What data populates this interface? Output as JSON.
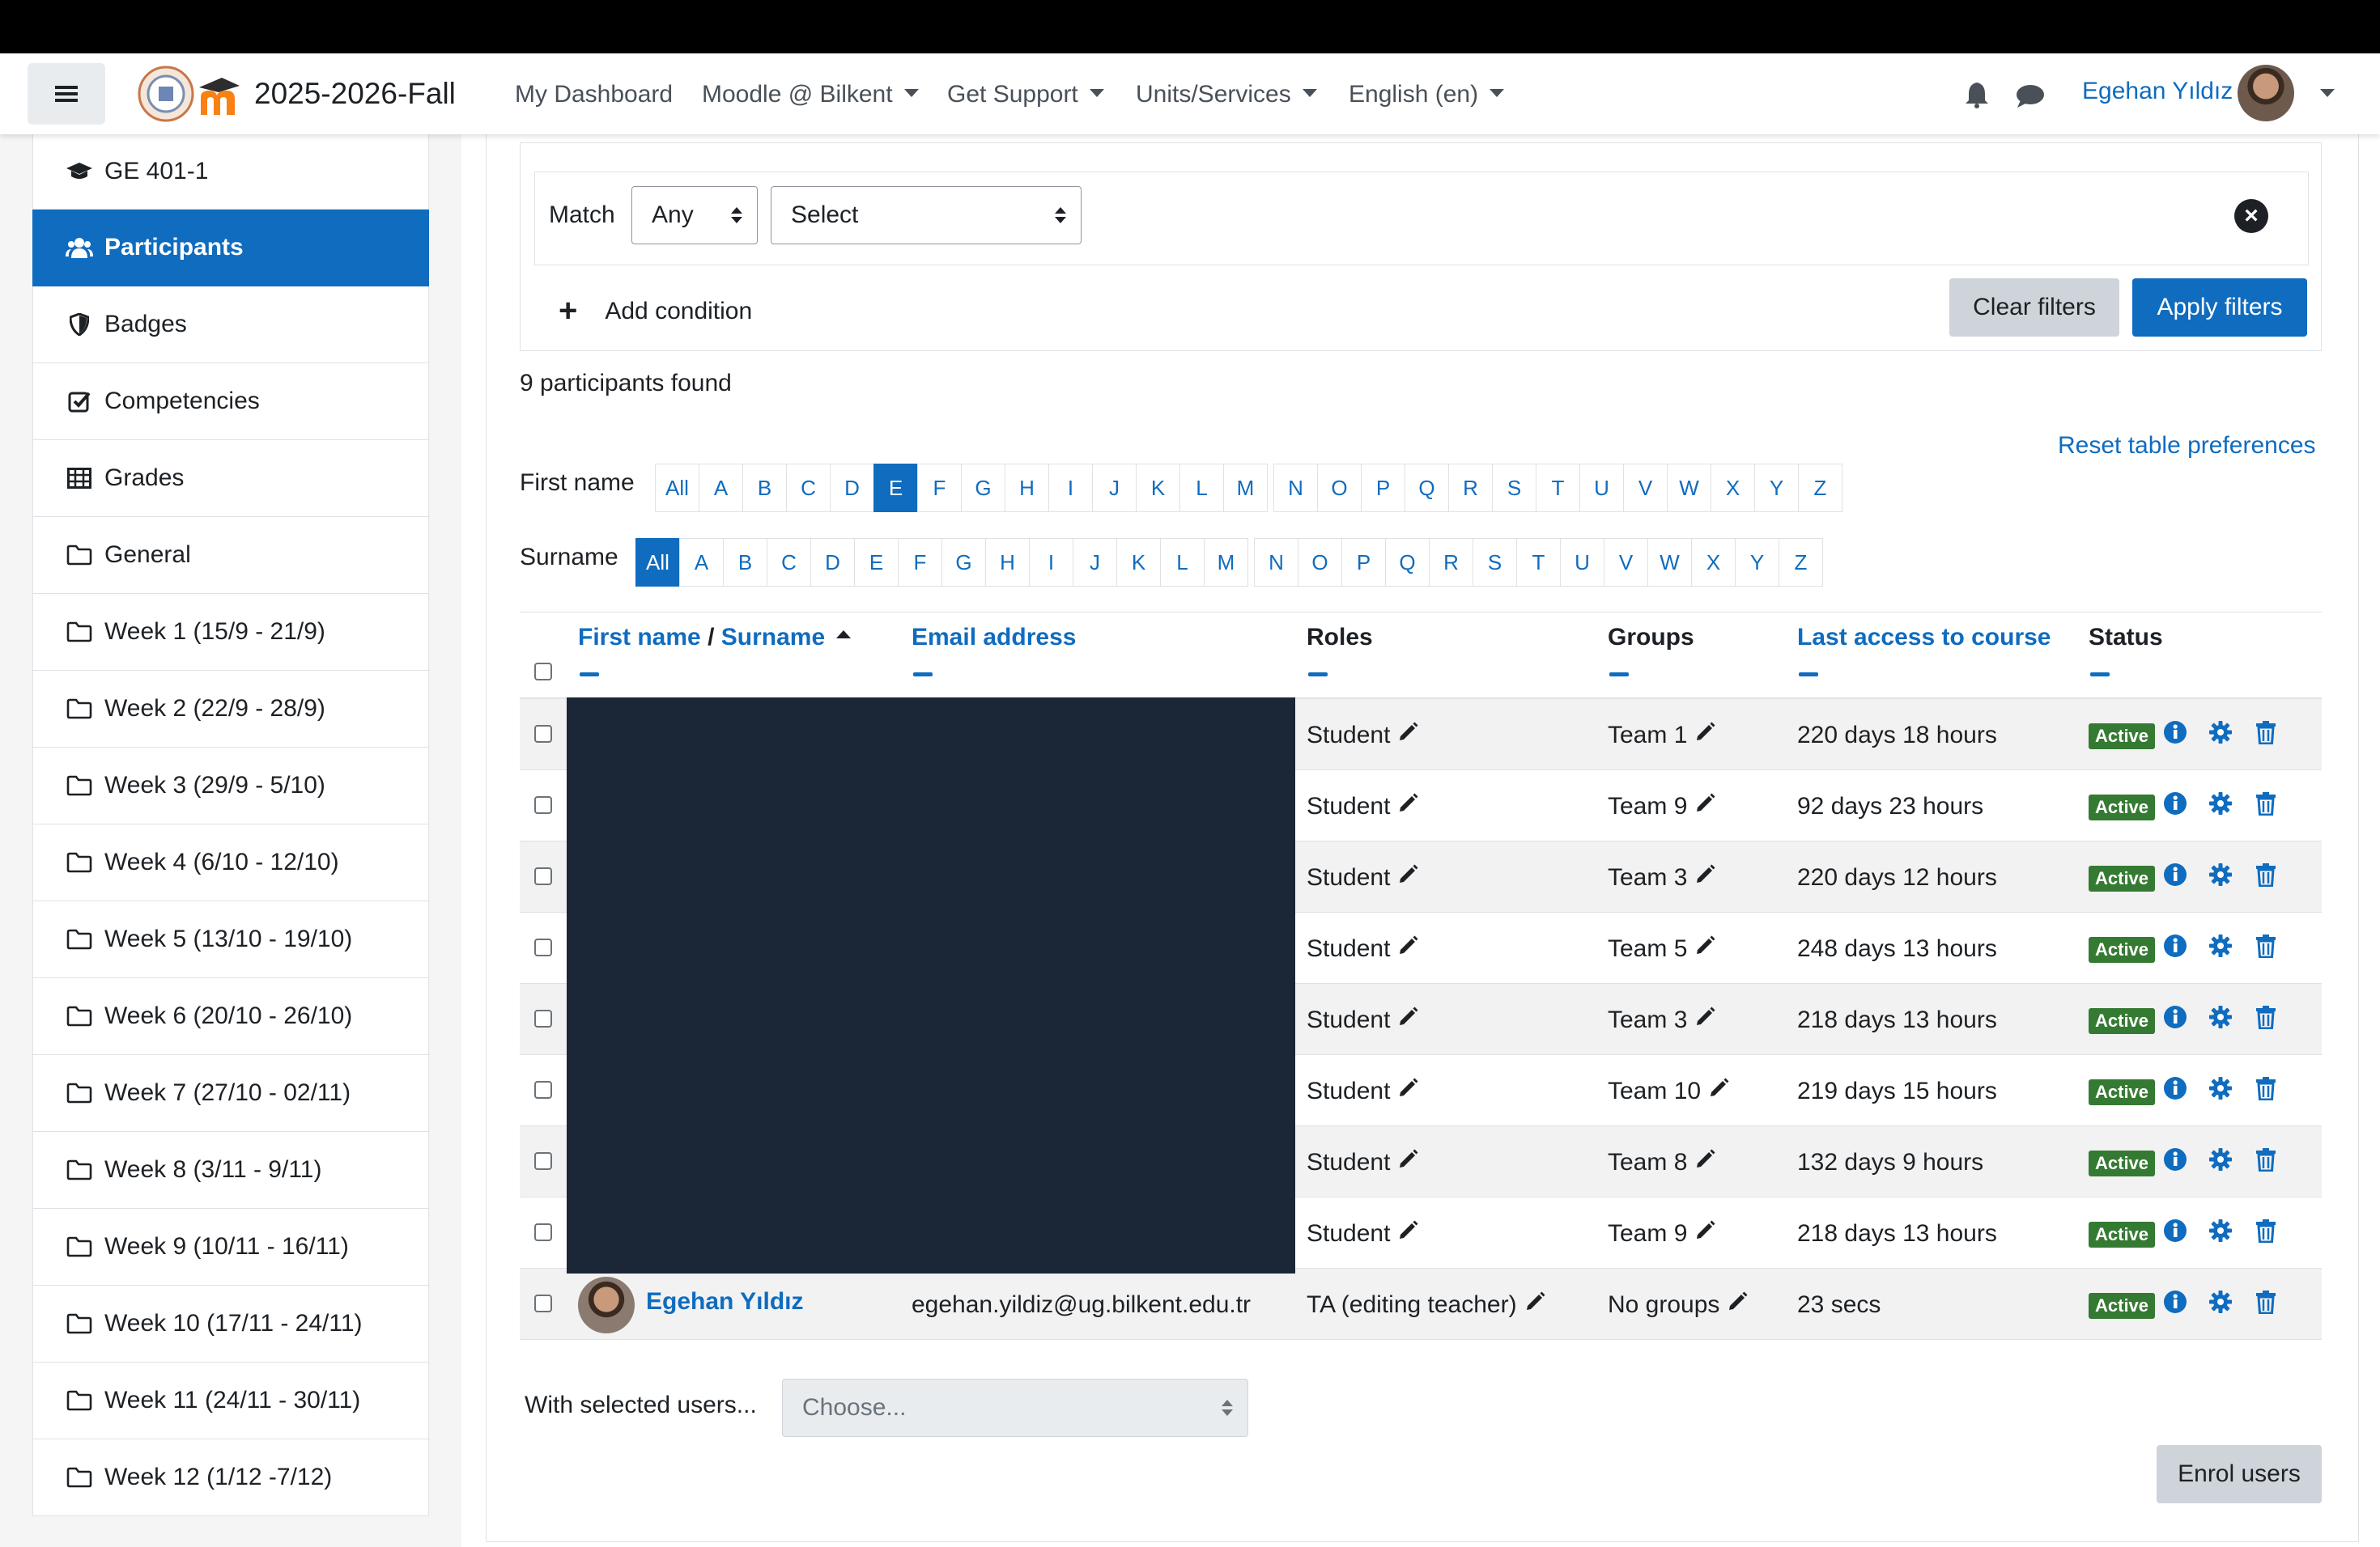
{
  "navbar": {
    "site_title": "2025-2026-Fall",
    "links": [
      "My Dashboard",
      "Moodle @ Bilkent",
      "Get Support",
      "Units/Services",
      "English (en)"
    ],
    "user_name": "Egehan Yıldız"
  },
  "sidebar": {
    "items": [
      {
        "label": "GE 401-1",
        "icon": "graduation-cap-icon"
      },
      {
        "label": "Participants",
        "icon": "users-icon",
        "active": true
      },
      {
        "label": "Badges",
        "icon": "shield-icon"
      },
      {
        "label": "Competencies",
        "icon": "check-square-icon"
      },
      {
        "label": "Grades",
        "icon": "table-icon"
      },
      {
        "label": "General",
        "icon": "folder-icon"
      },
      {
        "label": "Week 1 (15/9 - 21/9)",
        "icon": "folder-icon"
      },
      {
        "label": "Week 2 (22/9 - 28/9)",
        "icon": "folder-icon"
      },
      {
        "label": "Week 3 (29/9 - 5/10)",
        "icon": "folder-icon"
      },
      {
        "label": "Week 4 (6/10 - 12/10)",
        "icon": "folder-icon"
      },
      {
        "label": "Week 5 (13/10 - 19/10)",
        "icon": "folder-icon"
      },
      {
        "label": "Week 6 (20/10 - 26/10)",
        "icon": "folder-icon"
      },
      {
        "label": "Week 7 (27/10 - 02/11)",
        "icon": "folder-icon"
      },
      {
        "label": "Week 8 (3/11 - 9/11)",
        "icon": "folder-icon"
      },
      {
        "label": "Week 9 (10/11 - 16/11)",
        "icon": "folder-icon"
      },
      {
        "label": "Week 10 (17/11 - 24/11)",
        "icon": "folder-icon"
      },
      {
        "label": "Week 11 (24/11 - 30/11)",
        "icon": "folder-icon"
      },
      {
        "label": "Week 12 (1/12 -7/12)",
        "icon": "folder-icon"
      }
    ]
  },
  "filter": {
    "match_label": "Match",
    "match_value": "Any",
    "type_value": "Select",
    "add_condition": "Add condition",
    "clear_label": "Clear filters",
    "apply_label": "Apply filters"
  },
  "participants_found": "9 participants found",
  "reset_preferences": "Reset table preferences",
  "initials": {
    "firstname_label": "First name",
    "surname_label": "Surname",
    "letters": [
      "All",
      "A",
      "B",
      "C",
      "D",
      "E",
      "F",
      "G",
      "H",
      "I",
      "J",
      "K",
      "L",
      "M",
      "N",
      "O",
      "P",
      "Q",
      "R",
      "S",
      "T",
      "U",
      "V",
      "W",
      "X",
      "Y",
      "Z"
    ],
    "firstname_selected": "E",
    "surname_selected": "All"
  },
  "table": {
    "headers": {
      "first_name": "First name",
      "separator": "/",
      "surname": "Surname",
      "email": "Email address",
      "roles": "Roles",
      "groups": "Groups",
      "last_access": "Last access to course",
      "status": "Status"
    },
    "rows": [
      {
        "name": "",
        "email": "",
        "role": "Student",
        "group": "Team 1",
        "last_access": "220 days 18 hours",
        "status": "Active"
      },
      {
        "name": "",
        "email": "",
        "role": "Student",
        "group": "Team 9",
        "last_access": "92 days 23 hours",
        "status": "Active"
      },
      {
        "name": "",
        "email": "",
        "role": "Student",
        "group": "Team 3",
        "last_access": "220 days 12 hours",
        "status": "Active"
      },
      {
        "name": "",
        "email": "",
        "role": "Student",
        "group": "Team 5",
        "last_access": "248 days 13 hours",
        "status": "Active"
      },
      {
        "name": "",
        "email": "",
        "role": "Student",
        "group": "Team 3",
        "last_access": "218 days 13 hours",
        "status": "Active"
      },
      {
        "name": "",
        "email": "",
        "role": "Student",
        "group": "Team 10",
        "last_access": "219 days 15 hours",
        "status": "Active"
      },
      {
        "name": "",
        "email": "",
        "role": "Student",
        "group": "Team 8",
        "last_access": "132 days 9 hours",
        "status": "Active"
      },
      {
        "name": "",
        "email": "",
        "role": "Student",
        "group": "Team 9",
        "last_access": "218 days 13 hours",
        "status": "Active"
      },
      {
        "name": "Egehan Yıldız",
        "email": "egehan.yildiz@ug.bilkent.edu.tr",
        "role": "TA (editing teacher)",
        "group": "No groups",
        "last_access": "23 secs",
        "status": "Active"
      }
    ]
  },
  "bulk": {
    "label": "With selected users...",
    "placeholder": "Choose...",
    "enrol_label": "Enrol users"
  },
  "colors": {
    "primary": "#0f6cbf",
    "active_badge": "#357a32"
  }
}
